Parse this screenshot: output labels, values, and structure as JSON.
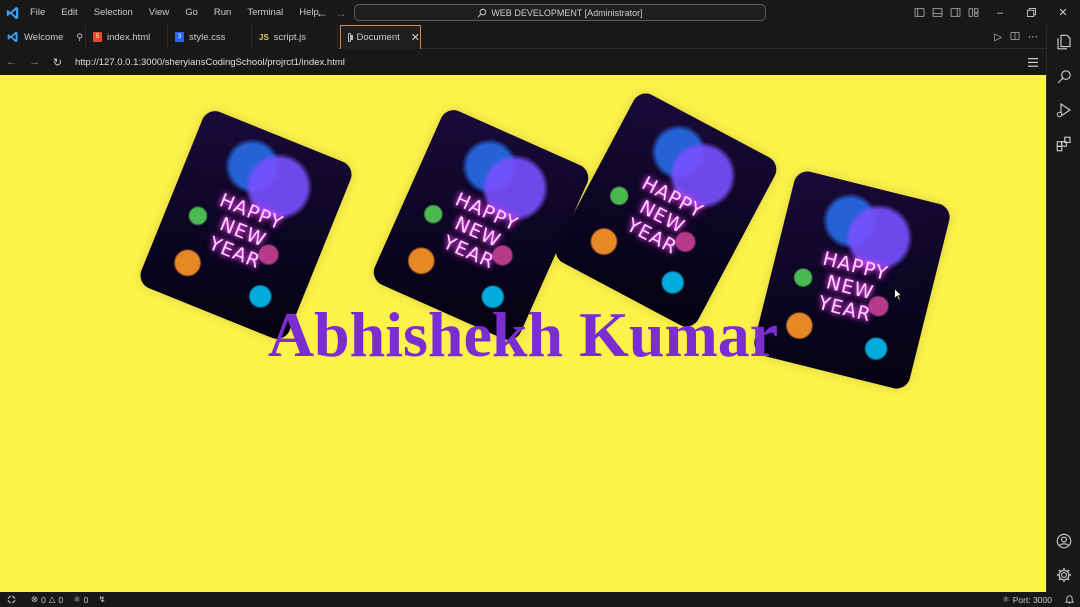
{
  "titlebar": {
    "menu": [
      "File",
      "Edit",
      "Selection",
      "View",
      "Go",
      "Run",
      "Terminal",
      "Help"
    ],
    "command_center": "WEB DEVELOPMENT [Administrator]"
  },
  "tabs": [
    {
      "label": "Welcome",
      "icon": "vscode-icon"
    },
    {
      "label": "index.html",
      "icon": "html-file-icon"
    },
    {
      "label": "style.css",
      "icon": "css-file-icon"
    },
    {
      "label": "script.js",
      "icon": "js-file-icon"
    },
    {
      "label": "Document",
      "icon": "browser-preview-icon",
      "active": true
    }
  ],
  "browser": {
    "url": "http://127.0.0.1:3000/sheryiansCodingSchool/projrct1/index.html"
  },
  "page": {
    "background": "#fdf24a",
    "headline": "Abhishekh Kumar",
    "headline_color": "#7a2dd0",
    "cards": [
      {
        "line1": "HAPPY",
        "line2": "NEW",
        "line3": "YEAR"
      },
      {
        "line1": "HAPPY",
        "line2": "NEW",
        "line3": "YEAR"
      },
      {
        "line1": "HAPPY",
        "line2": "NEW",
        "line3": "YEAR"
      },
      {
        "line1": "HAPPY",
        "line2": "NEW",
        "line3": "YEAR"
      }
    ]
  },
  "statusbar": {
    "errors": "0",
    "warnings": "0",
    "ports_count": "0",
    "port": "Port: 3000"
  }
}
